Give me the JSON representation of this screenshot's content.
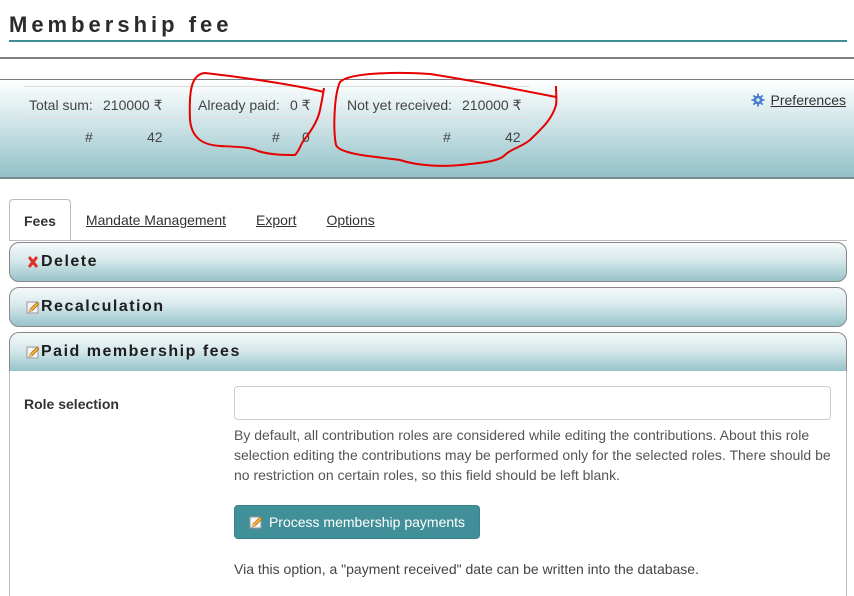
{
  "page": {
    "title": "Membership fee"
  },
  "summary": {
    "total": {
      "label": "Total sum:",
      "amount": "210000 ₹",
      "count_label": "#",
      "count": "42"
    },
    "paid": {
      "label": "Already paid:",
      "amount": "0 ₹",
      "count_label": "#",
      "count": "0"
    },
    "pending": {
      "label": "Not yet received:",
      "amount": "210000 ₹",
      "count_label": "#",
      "count": "42"
    },
    "preferences": {
      "icon": "gear-icon",
      "label": "Preferences"
    }
  },
  "tabs": [
    {
      "label": "Fees",
      "active": true
    },
    {
      "label": "Mandate Management",
      "active": false
    },
    {
      "label": "Export",
      "active": false
    },
    {
      "label": "Options",
      "active": false
    }
  ],
  "accordion": [
    {
      "icon": "delete-x-icon",
      "title": "Delete",
      "open": false
    },
    {
      "icon": "pencil-icon",
      "title": "Recalculation",
      "open": false
    },
    {
      "icon": "pencil-icon",
      "title": "Paid membership fees",
      "open": true
    }
  ],
  "paid_fees": {
    "role_label": "Role selection",
    "role_value": "",
    "role_help": "By default, all contribution roles are considered while editing the contributions. About this role selection editing the contributions may be performed only for the selected roles. There should be no restriction on certain roles, so this field should be left blank.",
    "button_label": "Process membership payments",
    "button_note": "Via this option, a \"payment received\" date can be written into the database."
  },
  "colors": {
    "accent": "#418f98",
    "annotation": "#e60000"
  }
}
